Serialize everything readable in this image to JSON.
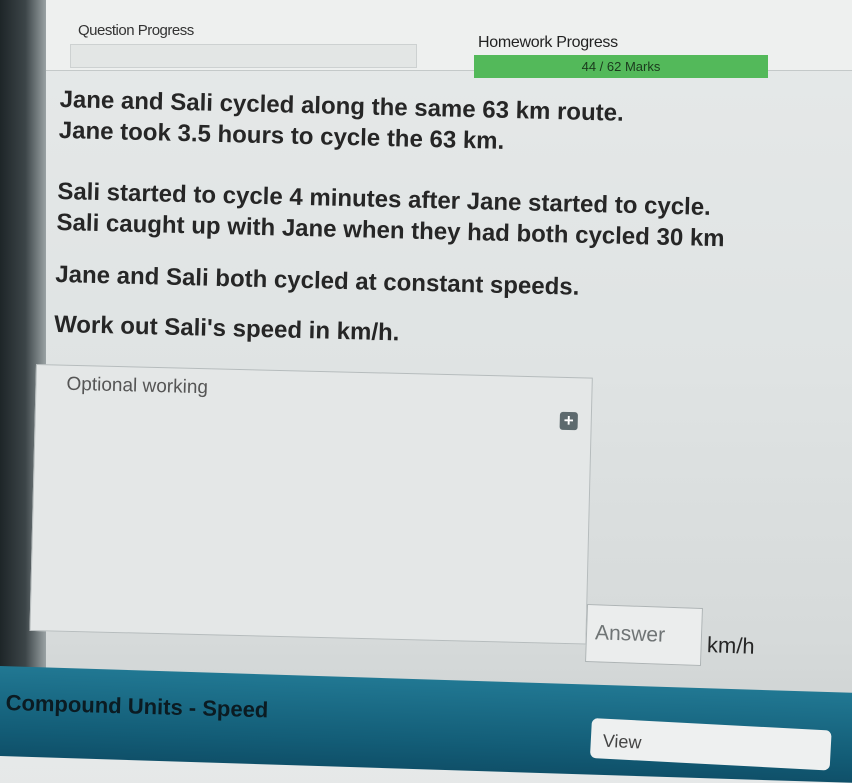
{
  "header": {
    "question_progress_label": "Question Progress",
    "homework_progress_label": "Homework Progress",
    "marks_text": "44 / 62 Marks",
    "marks_fraction": 0.71
  },
  "question": {
    "lines": [
      "Jane and Sali cycled along the same 63 km route.",
      "Jane took 3.5 hours to cycle the 63 km.",
      "Sali started to cycle 4 minutes after Jane started to cycle.",
      "Sali caught up with Jane when they had both cycled 30 km",
      "Jane and Sali both cycled at constant speeds.",
      "Work out Sali's speed in km/h."
    ]
  },
  "working": {
    "label": "Optional working",
    "add_icon": "plus-icon"
  },
  "answer": {
    "placeholder": "Answer",
    "unit": "km/h"
  },
  "footer": {
    "topic_title": "Compound Units - Speed",
    "view_button_label": "View"
  }
}
